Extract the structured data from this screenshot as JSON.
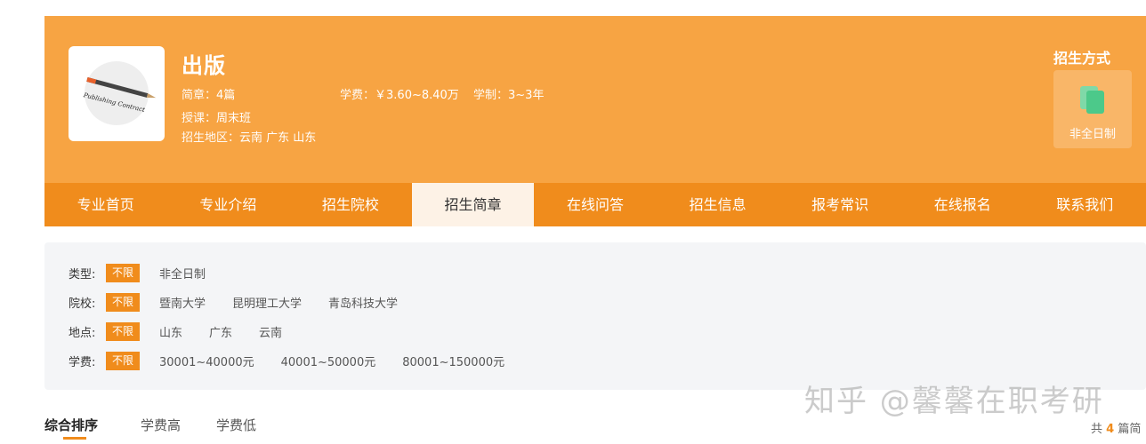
{
  "banner": {
    "logo_text": "Publishing Contract",
    "title": "出版",
    "brief": {
      "label": "简章：",
      "value": "4篇"
    },
    "fee": {
      "label": "学费：",
      "value": "￥3.60~8.40万"
    },
    "duration": {
      "label": "学制：",
      "value": "3~3年"
    },
    "teaching": {
      "label": "授课：",
      "value": "周末班"
    },
    "region": {
      "label": "招生地区：",
      "value": "云南 广东 山东"
    },
    "enroll_title": "招生方式",
    "enroll_mode": "非全日制"
  },
  "nav": [
    "专业首页",
    "专业介绍",
    "招生院校",
    "招生简章",
    "在线问答",
    "招生信息",
    "报考常识",
    "在线报名",
    "联系我们"
  ],
  "filters": {
    "all_label": "不限",
    "type": {
      "label": "类型:",
      "options": [
        "非全日制"
      ]
    },
    "school": {
      "label": "院校:",
      "options": [
        "暨南大学",
        "昆明理工大学",
        "青岛科技大学"
      ]
    },
    "location": {
      "label": "地点:",
      "options": [
        "山东",
        "广东",
        "云南"
      ]
    },
    "fee": {
      "label": "学费:",
      "options": [
        "30001~40000元",
        "40001~50000元",
        "80001~150000元"
      ]
    }
  },
  "sort": {
    "items": [
      "综合排序",
      "学费高",
      "学费低"
    ]
  },
  "count": {
    "prefix": "共",
    "num": "4",
    "suffix": "篇简"
  },
  "watermark": "知乎 @馨馨在职考研",
  "colors": {
    "banner": "#f7a443",
    "nav": "#f08c1c",
    "accent": "#f08c1c"
  }
}
